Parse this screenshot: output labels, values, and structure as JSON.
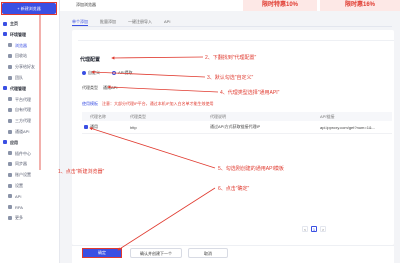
{
  "sidebar": {
    "new_browser": "+ 新建浏览器",
    "items": [
      {
        "label": "主页",
        "section": true
      },
      {
        "label": "环境管理",
        "section": true
      },
      {
        "label": "浏览器",
        "child": true,
        "active": true
      },
      {
        "label": "回收站",
        "child": true
      },
      {
        "label": "分享给好友",
        "child": true
      },
      {
        "label": "团队",
        "child": true
      },
      {
        "label": "代理管理",
        "section": true
      },
      {
        "label": "平台代理",
        "child": true
      },
      {
        "label": "自有代理",
        "child": true
      },
      {
        "label": "三方代理",
        "child": true
      },
      {
        "label": "通道API",
        "child": true
      },
      {
        "label": "应用",
        "section": true
      },
      {
        "label": "插件中心",
        "child": true
      },
      {
        "label": "同步器",
        "child": true
      },
      {
        "label": "账户设置",
        "child": true
      },
      {
        "label": "设置",
        "child": true
      },
      {
        "label": "API",
        "child": true
      },
      {
        "label": "RPA",
        "child": true
      },
      {
        "label": "更多",
        "child": true
      }
    ]
  },
  "topbar": {
    "window_title": "添加浏览器",
    "promo1": "限时特惠10%",
    "promo2": "限时惠16%"
  },
  "tabs": [
    {
      "label": "单个添加",
      "active": true
    },
    {
      "label": "批量添加",
      "active": false
    },
    {
      "label": "一键注册导入",
      "active": false
    },
    {
      "label": "API",
      "active": false
    }
  ],
  "proxy": {
    "section_title": "代理配置",
    "radio_custom": "自定义",
    "radio_api": "API提取",
    "type_label": "代理类型",
    "type_value": "通用API",
    "hint_tab": "使用模板",
    "hint_text": "注意：大部分代理IP平台，通过本机IP加入白名单才能生效使用"
  },
  "table": {
    "headers": [
      "",
      "代理名称",
      "代理类型",
      "代理说明",
      "API链接"
    ],
    "rows": [
      {
        "name": "通用",
        "type": "http",
        "desc": "通过API方式获取链接代理IP",
        "api": "api.ipproxy.com/get?num=1&..."
      }
    ]
  },
  "pager": [
    "<",
    "1",
    ">"
  ],
  "buttons": {
    "ok": "确定",
    "secondary": "确认并创建下一个",
    "cancel": "取消"
  },
  "annotations": {
    "a1": "1、点击\"新建浏览器\"",
    "a2": "2、下翻找到\"代理配置\"",
    "a3": "3、默认勾选\"自定义\"",
    "a4": "4、代理类型选择\"通用API\"",
    "a5": "5、勾选刚创建的通用API模板",
    "a6": "6、点击\"确定\""
  },
  "colors": {
    "accent": "#3a4fe3",
    "annotation": "#e03a2f"
  }
}
